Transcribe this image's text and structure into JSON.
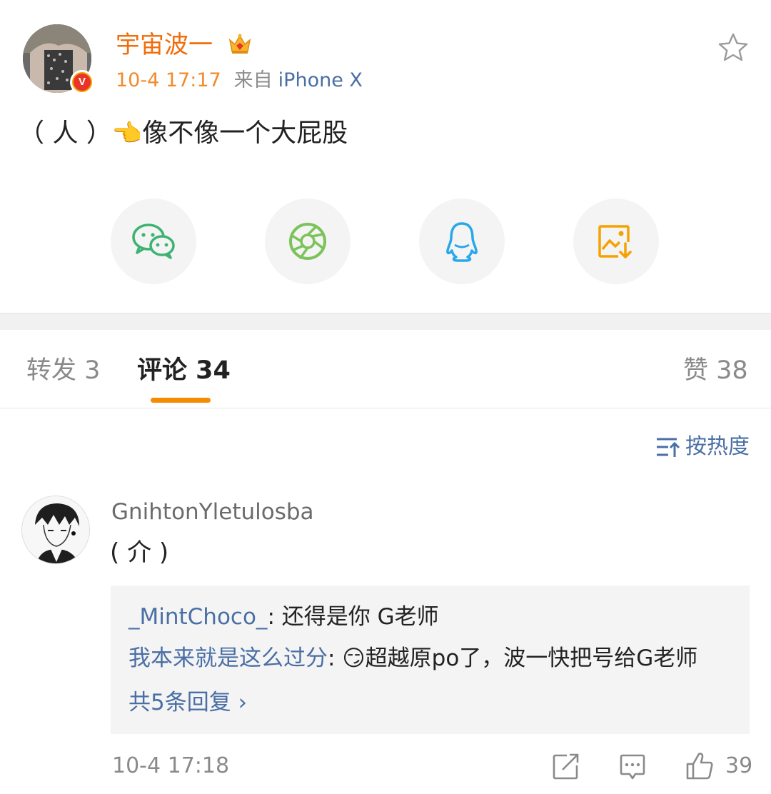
{
  "post": {
    "username": "宇宙波一",
    "time": "10-4 17:17",
    "from_label": "来自",
    "device": "iPhone X",
    "text_left": "（ 人 ）",
    "text_right": "像不像一个大屁股",
    "verified_badge": "V",
    "icons": {
      "crown": "crown-vip-icon",
      "favorite": "star-outline-icon",
      "pointing_hand": "👈"
    }
  },
  "share": {
    "items": [
      {
        "name": "wechat",
        "icon": "wechat-icon",
        "color": "#3cb371"
      },
      {
        "name": "moments",
        "icon": "moments-aperture-icon",
        "color": "#7cc35b"
      },
      {
        "name": "qq",
        "icon": "qq-penguin-icon",
        "color": "#2aa7ea"
      },
      {
        "name": "save-image",
        "icon": "save-image-icon",
        "color": "#f5a100"
      }
    ]
  },
  "tabs": {
    "repost": "转发 3",
    "comments": "评论 34",
    "likes": "赞 38"
  },
  "sort": {
    "label": "按热度"
  },
  "comment": {
    "username": "GnihtonYletulosba",
    "text": "( 介 )",
    "replies": [
      {
        "user": "_MintChoco_",
        "sep": ": ",
        "text": "还得是你 G老师"
      },
      {
        "user": "我本来就是这么过分",
        "sep": ": ",
        "emoji": "😏",
        "text": "超越原po了，波一快把号给G老师"
      }
    ],
    "more_replies": "共5条回复 ›",
    "time": "10-4 17:18",
    "like_count": "39"
  },
  "colors": {
    "accent_orange": "#f58b00",
    "link_blue": "#4a6fa5",
    "username_orange": "#f26c0a"
  }
}
